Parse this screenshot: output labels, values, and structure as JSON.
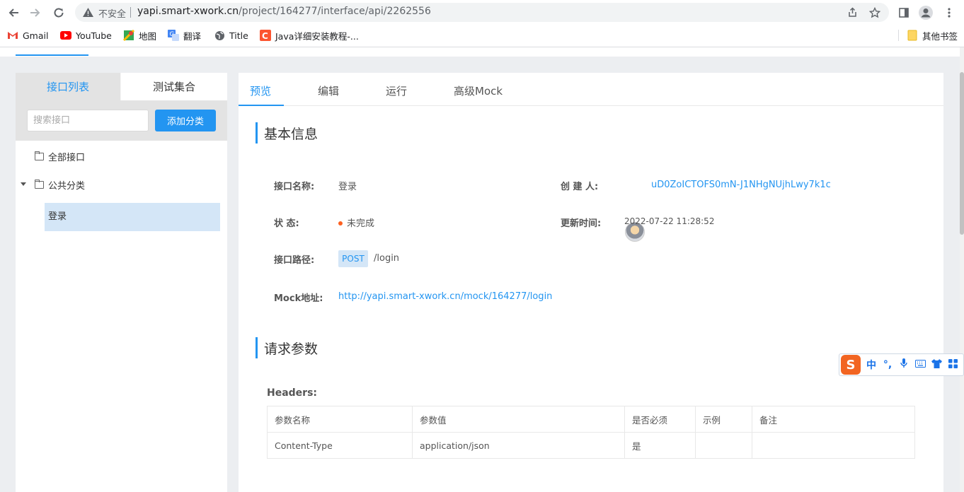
{
  "browser": {
    "insecure_label": "不安全",
    "url_host": "yapi.smart-xwork.cn",
    "url_path": "/project/164277/interface/api/2262556",
    "bookmarks": [
      {
        "label": "Gmail",
        "icon": "gmail-icon"
      },
      {
        "label": "YouTube",
        "icon": "youtube-icon"
      },
      {
        "label": "地图",
        "icon": "maps-icon"
      },
      {
        "label": "翻译",
        "icon": "translate-icon"
      },
      {
        "label": "Title",
        "icon": "globe-icon"
      },
      {
        "label": "Java详细安装教程-...",
        "icon": "csdn-icon"
      }
    ],
    "other_bookmarks": "其他书签"
  },
  "left_panel": {
    "tabs": [
      {
        "label": "接口列表",
        "active": true
      },
      {
        "label": "测试集合",
        "active": false
      }
    ],
    "search_placeholder": "搜索接口",
    "add_category_label": "添加分类",
    "tree": {
      "all": "全部接口",
      "category": "公共分类",
      "apis": [
        "登录"
      ]
    }
  },
  "right_panel": {
    "tabs": [
      {
        "label": "预览",
        "active": true
      },
      {
        "label": "编辑",
        "active": false
      },
      {
        "label": "运行",
        "active": false
      },
      {
        "label": "高级Mock",
        "active": false
      }
    ],
    "basic_info": {
      "title": "基本信息",
      "name_label": "接口名称:",
      "name_value": "登录",
      "creator_label": "创  建  人:",
      "creator_value": "uD0ZoICTOFS0mN-J1NHgNUjhLwy7k1c",
      "status_label": "状      态:",
      "status_value": "未完成",
      "status_color": "#fd6020",
      "updated_label": "更新时间:",
      "updated_value": "2022-07-22 11:28:52",
      "path_label": "接口路径:",
      "method": "POST",
      "path_value": "/login",
      "mock_label": "Mock地址:",
      "mock_value": "http://yapi.smart-xwork.cn/mock/164277/login"
    },
    "request_params": {
      "title": "请求参数",
      "headers_label": "Headers:",
      "columns": [
        "参数名称",
        "参数值",
        "是否必须",
        "示例",
        "备注"
      ],
      "rows": [
        [
          "Content-Type",
          "application/json",
          "是",
          "",
          ""
        ]
      ]
    }
  },
  "ime": {
    "items": [
      "中",
      "°,",
      "mic-icon",
      "keyboard-icon",
      "shirt-icon",
      "apps-icon"
    ]
  },
  "colors": {
    "accent": "#2395f1",
    "selected_bg": "#d4e6f7",
    "page_bg": "#eceef1"
  }
}
